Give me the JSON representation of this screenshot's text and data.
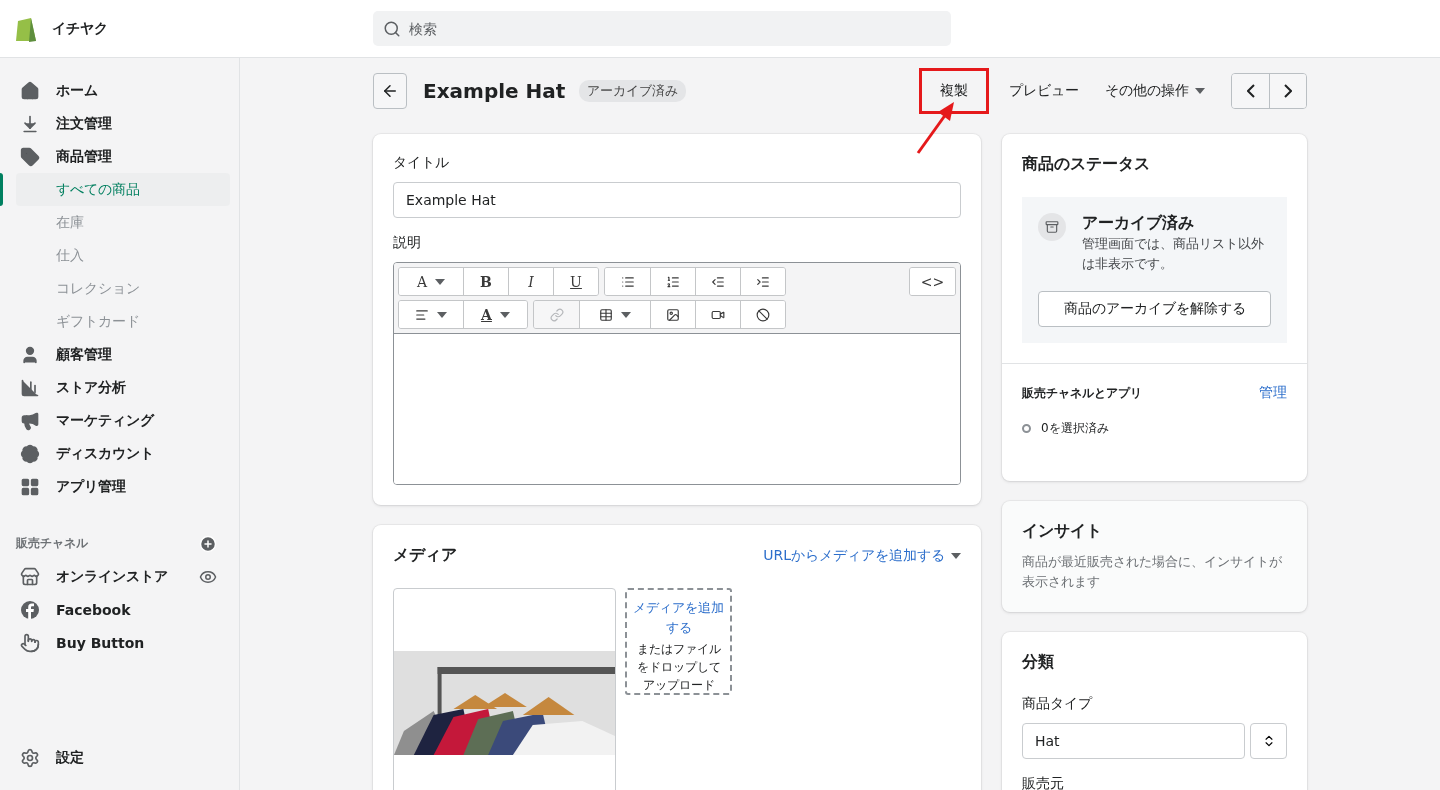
{
  "topbar": {
    "store_name": "イチヤク",
    "search": {
      "placeholder": "検索"
    }
  },
  "sidebar": {
    "items": [
      {
        "label": "ホーム",
        "selected": false
      },
      {
        "label": "注文管理",
        "selected": false
      },
      {
        "label": "商品管理",
        "selected": false,
        "children": [
          {
            "label": "すべての商品",
            "selected": true
          },
          {
            "label": "在庫",
            "selected": false
          },
          {
            "label": "仕入",
            "selected": false
          },
          {
            "label": "コレクション",
            "selected": false
          },
          {
            "label": "ギフトカード",
            "selected": false
          }
        ]
      },
      {
        "label": "顧客管理",
        "selected": false
      },
      {
        "label": "ストア分析",
        "selected": false
      },
      {
        "label": "マーケティング",
        "selected": false
      },
      {
        "label": "ディスカウント",
        "selected": false
      },
      {
        "label": "アプリ管理",
        "selected": false
      }
    ],
    "channels_heading": "販売チャネル",
    "channels": [
      {
        "label": "オンラインストア",
        "selected": false
      },
      {
        "label": "Facebook",
        "selected": false
      },
      {
        "label": "Buy Button",
        "selected": false
      }
    ],
    "settings": "設定"
  },
  "header": {
    "title": "Example Hat",
    "badge": "アーカイブ済み",
    "actions": [
      {
        "label": "複製",
        "highlighted": true,
        "caret": false
      },
      {
        "label": "プレビュー",
        "highlighted": false,
        "caret": false
      },
      {
        "label": "その他の操作",
        "highlighted": false,
        "caret": true
      }
    ]
  },
  "title_card": {
    "title_label": "タイトル",
    "title_value": "Example Hat",
    "description_label": "説明",
    "toolbar": [
      [
        [
          {
            "label": "A",
            "caret": true,
            "disabled": false
          },
          {
            "label": "B",
            "caret": false,
            "disabled": false
          },
          {
            "label": "I",
            "caret": false,
            "disabled": false
          },
          {
            "label": "U",
            "caret": false,
            "disabled": false
          }
        ],
        [
          {
            "caret": false,
            "disabled": false
          },
          {
            "caret": false,
            "disabled": false
          },
          {
            "caret": false,
            "disabled": false
          },
          {
            "caret": false,
            "disabled": false
          }
        ],
        [
          {
            "label": "<>",
            "caret": false,
            "disabled": false
          }
        ]
      ],
      [
        [
          {
            "caret": true,
            "disabled": false
          },
          {
            "label": "A",
            "caret": true,
            "disabled": false
          }
        ],
        [
          {
            "caret": false,
            "disabled": true
          },
          {
            "caret": true,
            "disabled": false
          },
          {
            "caret": false,
            "disabled": false
          },
          {
            "caret": false,
            "disabled": false
          },
          {
            "caret": false,
            "disabled": false
          }
        ]
      ]
    ]
  },
  "media_card": {
    "heading": "メディア",
    "add_url": "URLからメディアを追加する",
    "drop": {
      "link": "メディアを追加する",
      "hint": "またはファイルをドロップしてアップロード"
    }
  },
  "status_card": {
    "heading": "商品のステータス",
    "status_title": "アーカイブ済み",
    "status_text": "管理画面では、商品リスト以外は非表示です。",
    "unarchive": "商品のアーカイブを解除する",
    "channels_heading": "販売チャネルとアプリ",
    "manage": "管理",
    "selected_count": "0を選択済み"
  },
  "insight_card": {
    "heading": "インサイト",
    "text": "商品が最近販売された場合に、インサイトが表示されます"
  },
  "classification_card": {
    "heading": "分類",
    "type_label": "商品タイプ",
    "type_value": "Hat",
    "vendor_label": "販売元"
  }
}
